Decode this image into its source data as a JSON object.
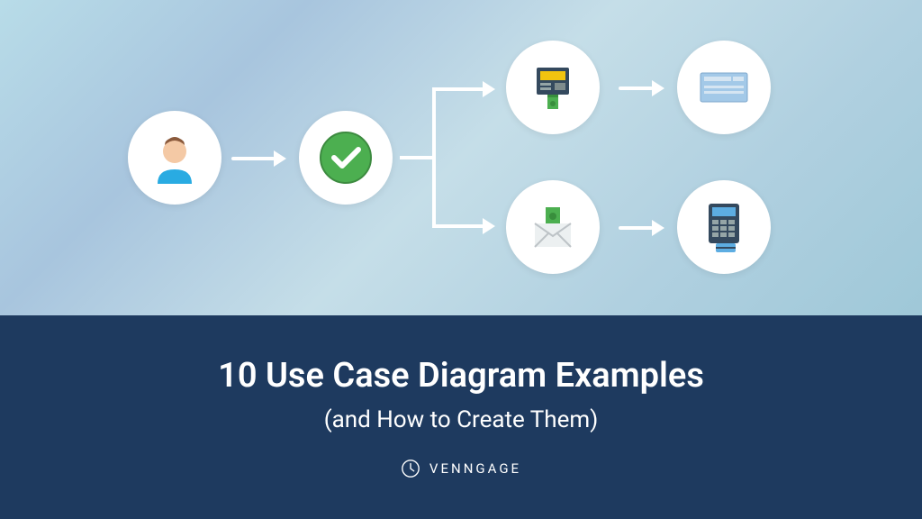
{
  "title": "10 Use Case Diagram Examples",
  "subtitle": "(and How to Create Them)",
  "brand": "VENNGAGE",
  "icons": {
    "user": "user-icon",
    "checkmark": "checkmark-icon",
    "atm": "atm-icon",
    "check": "bank-check-icon",
    "envelope": "money-envelope-icon",
    "terminal": "pos-terminal-icon"
  },
  "colors": {
    "footer": "#1e3a5f",
    "accent_green": "#4caf50",
    "accent_blue": "#29abe2"
  }
}
